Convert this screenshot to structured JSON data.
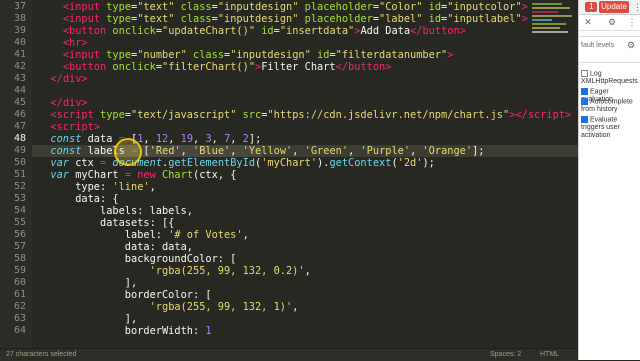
{
  "editor": {
    "current_line": 48,
    "lines": [
      {
        "n": 37,
        "tokens": [
          [
            "    ",
            "plain"
          ],
          [
            "<",
            "tag"
          ],
          [
            "input",
            "tag"
          ],
          [
            " type",
            "attr"
          ],
          [
            "=",
            "plain"
          ],
          [
            "\"text\"",
            "str"
          ],
          [
            " class",
            "attr"
          ],
          [
            "=",
            "plain"
          ],
          [
            "\"inputdesign\"",
            "str"
          ],
          [
            " placeholder",
            "attr"
          ],
          [
            "=",
            "plain"
          ],
          [
            "\"Color\"",
            "str"
          ],
          [
            " id",
            "attr"
          ],
          [
            "=",
            "plain"
          ],
          [
            "\"inputcolor\"",
            "str"
          ],
          [
            ">",
            "tag"
          ]
        ]
      },
      {
        "n": 38,
        "tokens": [
          [
            "    ",
            "plain"
          ],
          [
            "<",
            "tag"
          ],
          [
            "input",
            "tag"
          ],
          [
            " type",
            "attr"
          ],
          [
            "=",
            "plain"
          ],
          [
            "\"text\"",
            "str"
          ],
          [
            " class",
            "attr"
          ],
          [
            "=",
            "plain"
          ],
          [
            "\"inputdesign\"",
            "str"
          ],
          [
            " placeholder",
            "attr"
          ],
          [
            "=",
            "plain"
          ],
          [
            "\"label\"",
            "str"
          ],
          [
            " id",
            "attr"
          ],
          [
            "=",
            "plain"
          ],
          [
            "\"inputlabel\"",
            "str"
          ],
          [
            ">",
            "tag"
          ]
        ]
      },
      {
        "n": 39,
        "tokens": [
          [
            "    ",
            "plain"
          ],
          [
            "<",
            "tag"
          ],
          [
            "button",
            "tag"
          ],
          [
            " onclick",
            "attr"
          ],
          [
            "=",
            "plain"
          ],
          [
            "\"updateChart()\"",
            "str"
          ],
          [
            " id",
            "attr"
          ],
          [
            "=",
            "plain"
          ],
          [
            "\"insertdata\"",
            "str"
          ],
          [
            ">",
            "tag"
          ],
          [
            "Add Data",
            "plain"
          ],
          [
            "</",
            "tag"
          ],
          [
            "button",
            "tag"
          ],
          [
            ">",
            "tag"
          ]
        ]
      },
      {
        "n": 40,
        "tokens": [
          [
            "    ",
            "plain"
          ],
          [
            "<",
            "tag"
          ],
          [
            "hr",
            "tag"
          ],
          [
            ">",
            "tag"
          ]
        ]
      },
      {
        "n": 41,
        "tokens": [
          [
            "    ",
            "plain"
          ],
          [
            "<",
            "tag"
          ],
          [
            "input",
            "tag"
          ],
          [
            " type",
            "attr"
          ],
          [
            "=",
            "plain"
          ],
          [
            "\"number\"",
            "str"
          ],
          [
            " class",
            "attr"
          ],
          [
            "=",
            "plain"
          ],
          [
            "\"inputdesign\"",
            "str"
          ],
          [
            " id",
            "attr"
          ],
          [
            "=",
            "plain"
          ],
          [
            "\"filterdatanumber\"",
            "str"
          ],
          [
            ">",
            "tag"
          ]
        ]
      },
      {
        "n": 42,
        "tokens": [
          [
            "    ",
            "plain"
          ],
          [
            "<",
            "tag"
          ],
          [
            "button",
            "tag"
          ],
          [
            " onclick",
            "attr"
          ],
          [
            "=",
            "plain"
          ],
          [
            "\"filterChart()\"",
            "str"
          ],
          [
            ">",
            "tag"
          ],
          [
            "Filter Chart",
            "plain"
          ],
          [
            "</",
            "tag"
          ],
          [
            "button",
            "tag"
          ],
          [
            ">",
            "tag"
          ]
        ]
      },
      {
        "n": 43,
        "tokens": [
          [
            "  ",
            "plain"
          ],
          [
            "</",
            "tag"
          ],
          [
            "div",
            "tag"
          ],
          [
            ">",
            "tag"
          ]
        ]
      },
      {
        "n": 44,
        "tokens": [
          [
            "",
            "plain"
          ]
        ]
      },
      {
        "n": 45,
        "tokens": [
          [
            "  ",
            "plain"
          ],
          [
            "</",
            "tag"
          ],
          [
            "div",
            "tag"
          ],
          [
            ">",
            "tag"
          ]
        ]
      },
      {
        "n": 46,
        "tokens": [
          [
            "  ",
            "plain"
          ],
          [
            "<",
            "tag"
          ],
          [
            "script",
            "tag"
          ],
          [
            " type",
            "attr"
          ],
          [
            "=",
            "plain"
          ],
          [
            "\"text/javascript\"",
            "str"
          ],
          [
            " src",
            "attr"
          ],
          [
            "=",
            "plain"
          ],
          [
            "\"https://cdn.jsdelivr.net/npm/chart.js\"",
            "str"
          ],
          [
            "></",
            "tag"
          ],
          [
            "script",
            "tag"
          ],
          [
            ">",
            "tag"
          ]
        ]
      },
      {
        "n": 47,
        "tokens": [
          [
            "  ",
            "plain"
          ],
          [
            "<",
            "tag"
          ],
          [
            "script",
            "tag"
          ],
          [
            ">",
            "tag"
          ]
        ]
      },
      {
        "n": 48,
        "tokens": [
          [
            "  ",
            "plain"
          ],
          [
            "const",
            "kw"
          ],
          [
            " data ",
            "plain"
          ],
          [
            "=",
            "op"
          ],
          [
            " [",
            "plain"
          ],
          [
            "1",
            "num"
          ],
          [
            ", ",
            "plain"
          ],
          [
            "12",
            "num"
          ],
          [
            ", ",
            "plain"
          ],
          [
            "19",
            "num"
          ],
          [
            ", ",
            "plain"
          ],
          [
            "3",
            "num"
          ],
          [
            ", ",
            "plain"
          ],
          [
            "7",
            "num"
          ],
          [
            ", ",
            "plain"
          ],
          [
            "2",
            "num"
          ],
          [
            "];",
            "plain"
          ]
        ]
      },
      {
        "n": 49,
        "tokens": [
          [
            "  ",
            "plain"
          ],
          [
            "const",
            "kw"
          ],
          [
            " labels ",
            "plain"
          ],
          [
            "=",
            "op"
          ],
          [
            " [",
            "plain"
          ],
          [
            "'Red'",
            "str"
          ],
          [
            ", ",
            "plain"
          ],
          [
            "'Blue'",
            "str"
          ],
          [
            ", ",
            "plain"
          ],
          [
            "'Yellow'",
            "str"
          ],
          [
            ", ",
            "plain"
          ],
          [
            "'Green'",
            "str"
          ],
          [
            ", ",
            "plain"
          ],
          [
            "'Purple'",
            "str"
          ],
          [
            ", ",
            "plain"
          ],
          [
            "'Orange'",
            "str"
          ],
          [
            "];",
            "plain"
          ]
        ]
      },
      {
        "n": 50,
        "tokens": [
          [
            "  ",
            "plain"
          ],
          [
            "var",
            "kw"
          ],
          [
            " ctx ",
            "plain"
          ],
          [
            "=",
            "op"
          ],
          [
            " ",
            "plain"
          ],
          [
            "document",
            "kw"
          ],
          [
            ".",
            "plain"
          ],
          [
            "getElementById",
            "fn"
          ],
          [
            "(",
            "plain"
          ],
          [
            "'myChart'",
            "str"
          ],
          [
            ").",
            "plain"
          ],
          [
            "getContext",
            "fn"
          ],
          [
            "(",
            "plain"
          ],
          [
            "'2d'",
            "str"
          ],
          [
            ");",
            "plain"
          ]
        ]
      },
      {
        "n": 51,
        "tokens": [
          [
            "  ",
            "plain"
          ],
          [
            "var",
            "kw"
          ],
          [
            " myChart ",
            "plain"
          ],
          [
            "=",
            "op"
          ],
          [
            " ",
            "plain"
          ],
          [
            "new",
            "op"
          ],
          [
            " ",
            "plain"
          ],
          [
            "Chart",
            "obj"
          ],
          [
            "(ctx, {",
            "plain"
          ]
        ]
      },
      {
        "n": 52,
        "tokens": [
          [
            "      type: ",
            "plain"
          ],
          [
            "'line'",
            "str"
          ],
          [
            ",",
            "plain"
          ]
        ]
      },
      {
        "n": 53,
        "tokens": [
          [
            "      data: {",
            "plain"
          ]
        ]
      },
      {
        "n": 54,
        "tokens": [
          [
            "          labels: labels,",
            "plain"
          ]
        ]
      },
      {
        "n": 55,
        "tokens": [
          [
            "          datasets: [{",
            "plain"
          ]
        ]
      },
      {
        "n": 56,
        "tokens": [
          [
            "              label: ",
            "plain"
          ],
          [
            "'# of Votes'",
            "str"
          ],
          [
            ",",
            "plain"
          ]
        ]
      },
      {
        "n": 57,
        "tokens": [
          [
            "              data: data,",
            "plain"
          ]
        ]
      },
      {
        "n": 58,
        "tokens": [
          [
            "              backgroundColor: [",
            "plain"
          ]
        ]
      },
      {
        "n": 59,
        "tokens": [
          [
            "                  ",
            "plain"
          ],
          [
            "'rgba(255, 99, 132, 0.2)'",
            "str"
          ],
          [
            ",",
            "plain"
          ]
        ]
      },
      {
        "n": 60,
        "tokens": [
          [
            "              ],",
            "plain"
          ]
        ]
      },
      {
        "n": 61,
        "tokens": [
          [
            "              borderColor: [",
            "plain"
          ]
        ]
      },
      {
        "n": 62,
        "tokens": [
          [
            "                  ",
            "plain"
          ],
          [
            "'rgba(255, 99, 132, 1)'",
            "str"
          ],
          [
            ",",
            "plain"
          ]
        ]
      },
      {
        "n": 63,
        "tokens": [
          [
            "              ],",
            "plain"
          ]
        ]
      },
      {
        "n": 64,
        "tokens": [
          [
            "              borderWidth: ",
            "plain"
          ],
          [
            "1",
            "num"
          ]
        ]
      }
    ]
  },
  "devtools": {
    "badge": "1",
    "update_button": "Update",
    "more_icon": "kebab-icon",
    "levels_label": "fault levels",
    "options": [
      {
        "label": "Log XMLHttpRequests",
        "checked": false
      },
      {
        "label": "Eager evaluation",
        "checked": true
      },
      {
        "label": "Autocomplete from history",
        "checked": true
      },
      {
        "label": "Evaluate triggers user activation",
        "checked": true
      }
    ]
  },
  "statusbar": {
    "selection": "27 characters selected",
    "spaces": "Spaces: 2",
    "language": "HTML"
  },
  "colors": {
    "editor_bg": "#272822",
    "keyword": "#66d9ef",
    "string": "#e6db74",
    "tag": "#f92672",
    "attribute": "#a6e22e",
    "number": "#ae81ff",
    "update_button": "#e04b3d"
  }
}
